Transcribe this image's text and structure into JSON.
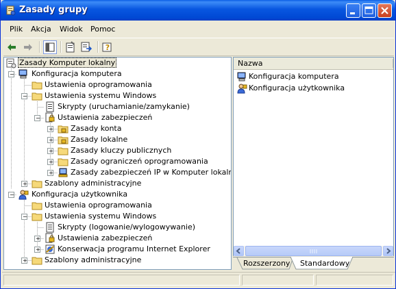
{
  "window": {
    "title": "Zasady grupy"
  },
  "menu": [
    "Plik",
    "Akcja",
    "Widok",
    "Pomoc"
  ],
  "toolbar": {
    "icons": [
      "back-arrow-icon",
      "forward-arrow-icon",
      "show-hide-tree-icon",
      "properties-icon",
      "export-list-icon",
      "help-icon"
    ]
  },
  "tree": {
    "root": "Zasady Komputer lokalny",
    "items": [
      "Konfiguracja komputera",
      "Ustawienia oprogramowania",
      "Ustawienia systemu Windows",
      "Skrypty (uruchamianie/zamykanie)",
      "Ustawienia zabezpieczeń",
      "Zasady konta",
      "Zasady lokalne",
      "Zasady kluczy publicznych",
      "Zasady ograniczeń oprogramowania",
      "Zasady zabezpieczeń IP w Komputer lokalny",
      "Szablony administracyjne",
      "Konfiguracja użytkownika",
      "Ustawienia oprogramowania",
      "Ustawienia systemu Windows",
      "Skrypty (logowanie/wylogowywanie)",
      "Ustawienia zabezpieczeń",
      "Konserwacja programu Internet Explorer",
      "Szablony administracyjne"
    ]
  },
  "list": {
    "column": "Nazwa",
    "items": [
      "Konfiguracja komputera",
      "Konfiguracja użytkownika"
    ]
  },
  "tabs": [
    "Rozszerzony",
    "Standardowy"
  ],
  "active_tab": "Standardowy"
}
